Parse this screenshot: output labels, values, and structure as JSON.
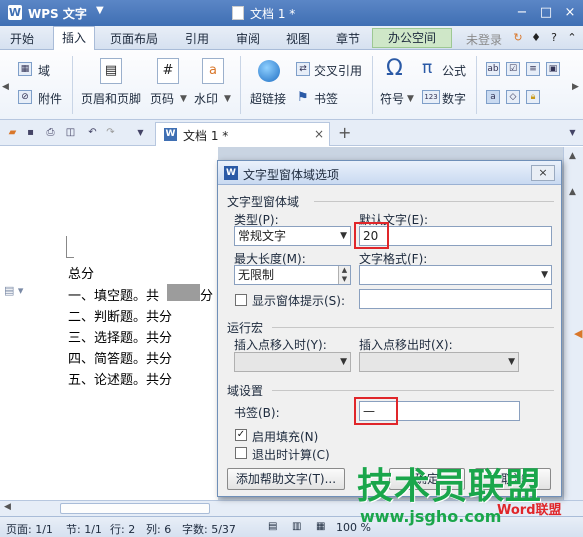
{
  "window": {
    "app_name": "WPS 文字",
    "app_logo": "W",
    "doc_title": "文档 1 *",
    "controls": [
      "−",
      "□",
      "×"
    ]
  },
  "menubar": {
    "items": [
      "开始",
      "插入",
      "页面布局",
      "引用",
      "审阅",
      "视图",
      "章节",
      "办公空间"
    ],
    "login": "未登录"
  },
  "ribbon": {
    "field": "域",
    "attachment": "附件",
    "header_footer": "页眉和页脚",
    "page_number": "页码",
    "watermark": "水印",
    "hyperlink": "超链接",
    "cross_reference": "交叉引用",
    "bookmark": "书签",
    "symbol": "符号",
    "formula": "公式",
    "number": "数字"
  },
  "tabbar": {
    "doc_tab": "文档 1 *",
    "new_tab": "+"
  },
  "document": {
    "lines": [
      "总分",
      "一、填空题。共",
      "二、判断题。共分",
      "三、选择题。共分",
      "四、简答题。共分",
      "五、论述题。共分"
    ],
    "line1_suffix": "分"
  },
  "dialog": {
    "title": "文字型窗体域选项",
    "close": "×",
    "group_field": "文字型窗体域",
    "type_label": "类型(P):",
    "type_value": "常规文字",
    "default_label": "默认文字(E):",
    "default_value": "20",
    "maxlen_label": "最大长度(M):",
    "maxlen_value": "无限制",
    "format_label": "文字格式(F):",
    "format_value": "",
    "show_hint_label": "显示窗体提示(S):",
    "show_hint_checked": false,
    "group_macro": "运行宏",
    "entry_label": "插入点移入时(Y):",
    "exit_label": "插入点移出时(X):",
    "group_settings": "域设置",
    "bookmark_label": "书签(B):",
    "bookmark_value": "—",
    "enable_fill_label": "启用填充(N)",
    "enable_fill_checked": true,
    "calc_on_exit_label": "退出时计算(C)",
    "calc_on_exit_checked": false,
    "help_button": "添加帮助文字(T)...",
    "ok_button": "确定",
    "cancel_button": "取消"
  },
  "statusbar": {
    "page": "页面: 1/1",
    "section": "节: 1/1",
    "row": "行: 2",
    "col": "列: 6",
    "words": "字数: 5/37",
    "zoom": "100 %"
  },
  "watermark": {
    "main": "技术员联盟",
    "url": "www.jsgho.com",
    "corner": "Word联盟"
  },
  "colors": {
    "title_blue": "#3f6fb3",
    "highlight_red": "#e0262a",
    "watermark_green": "#1aa64b"
  }
}
